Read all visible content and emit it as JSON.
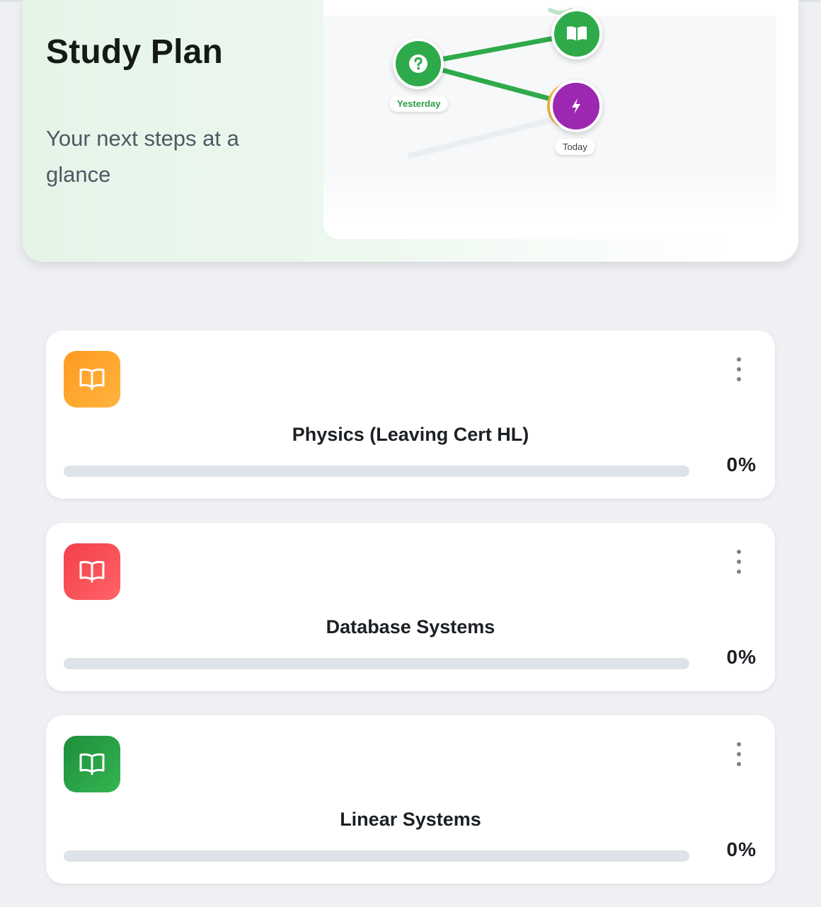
{
  "header": {
    "title": "Study Plan",
    "subtitle": "Your next steps at a glance"
  },
  "timeline": {
    "nodes": [
      {
        "icon": "question-icon",
        "color": "#2faa4b",
        "label": "Yesterday"
      },
      {
        "icon": "book-icon",
        "color": "#2faa4b"
      },
      {
        "icon": "bolt-icon",
        "color": "#9c27b0",
        "label": "Today"
      }
    ]
  },
  "subjects": [
    {
      "name": "Physics (Leaving Cert HL)",
      "progress_percent": 0,
      "progress_label": "0%",
      "icon": "book-icon",
      "color": "#ffa32e"
    },
    {
      "name": "Database Systems",
      "progress_percent": 0,
      "progress_label": "0%",
      "icon": "book-icon",
      "color": "#f45057"
    },
    {
      "name": "Linear Systems",
      "progress_percent": 0,
      "progress_label": "0%",
      "icon": "book-icon",
      "color": "#27a446"
    }
  ]
}
